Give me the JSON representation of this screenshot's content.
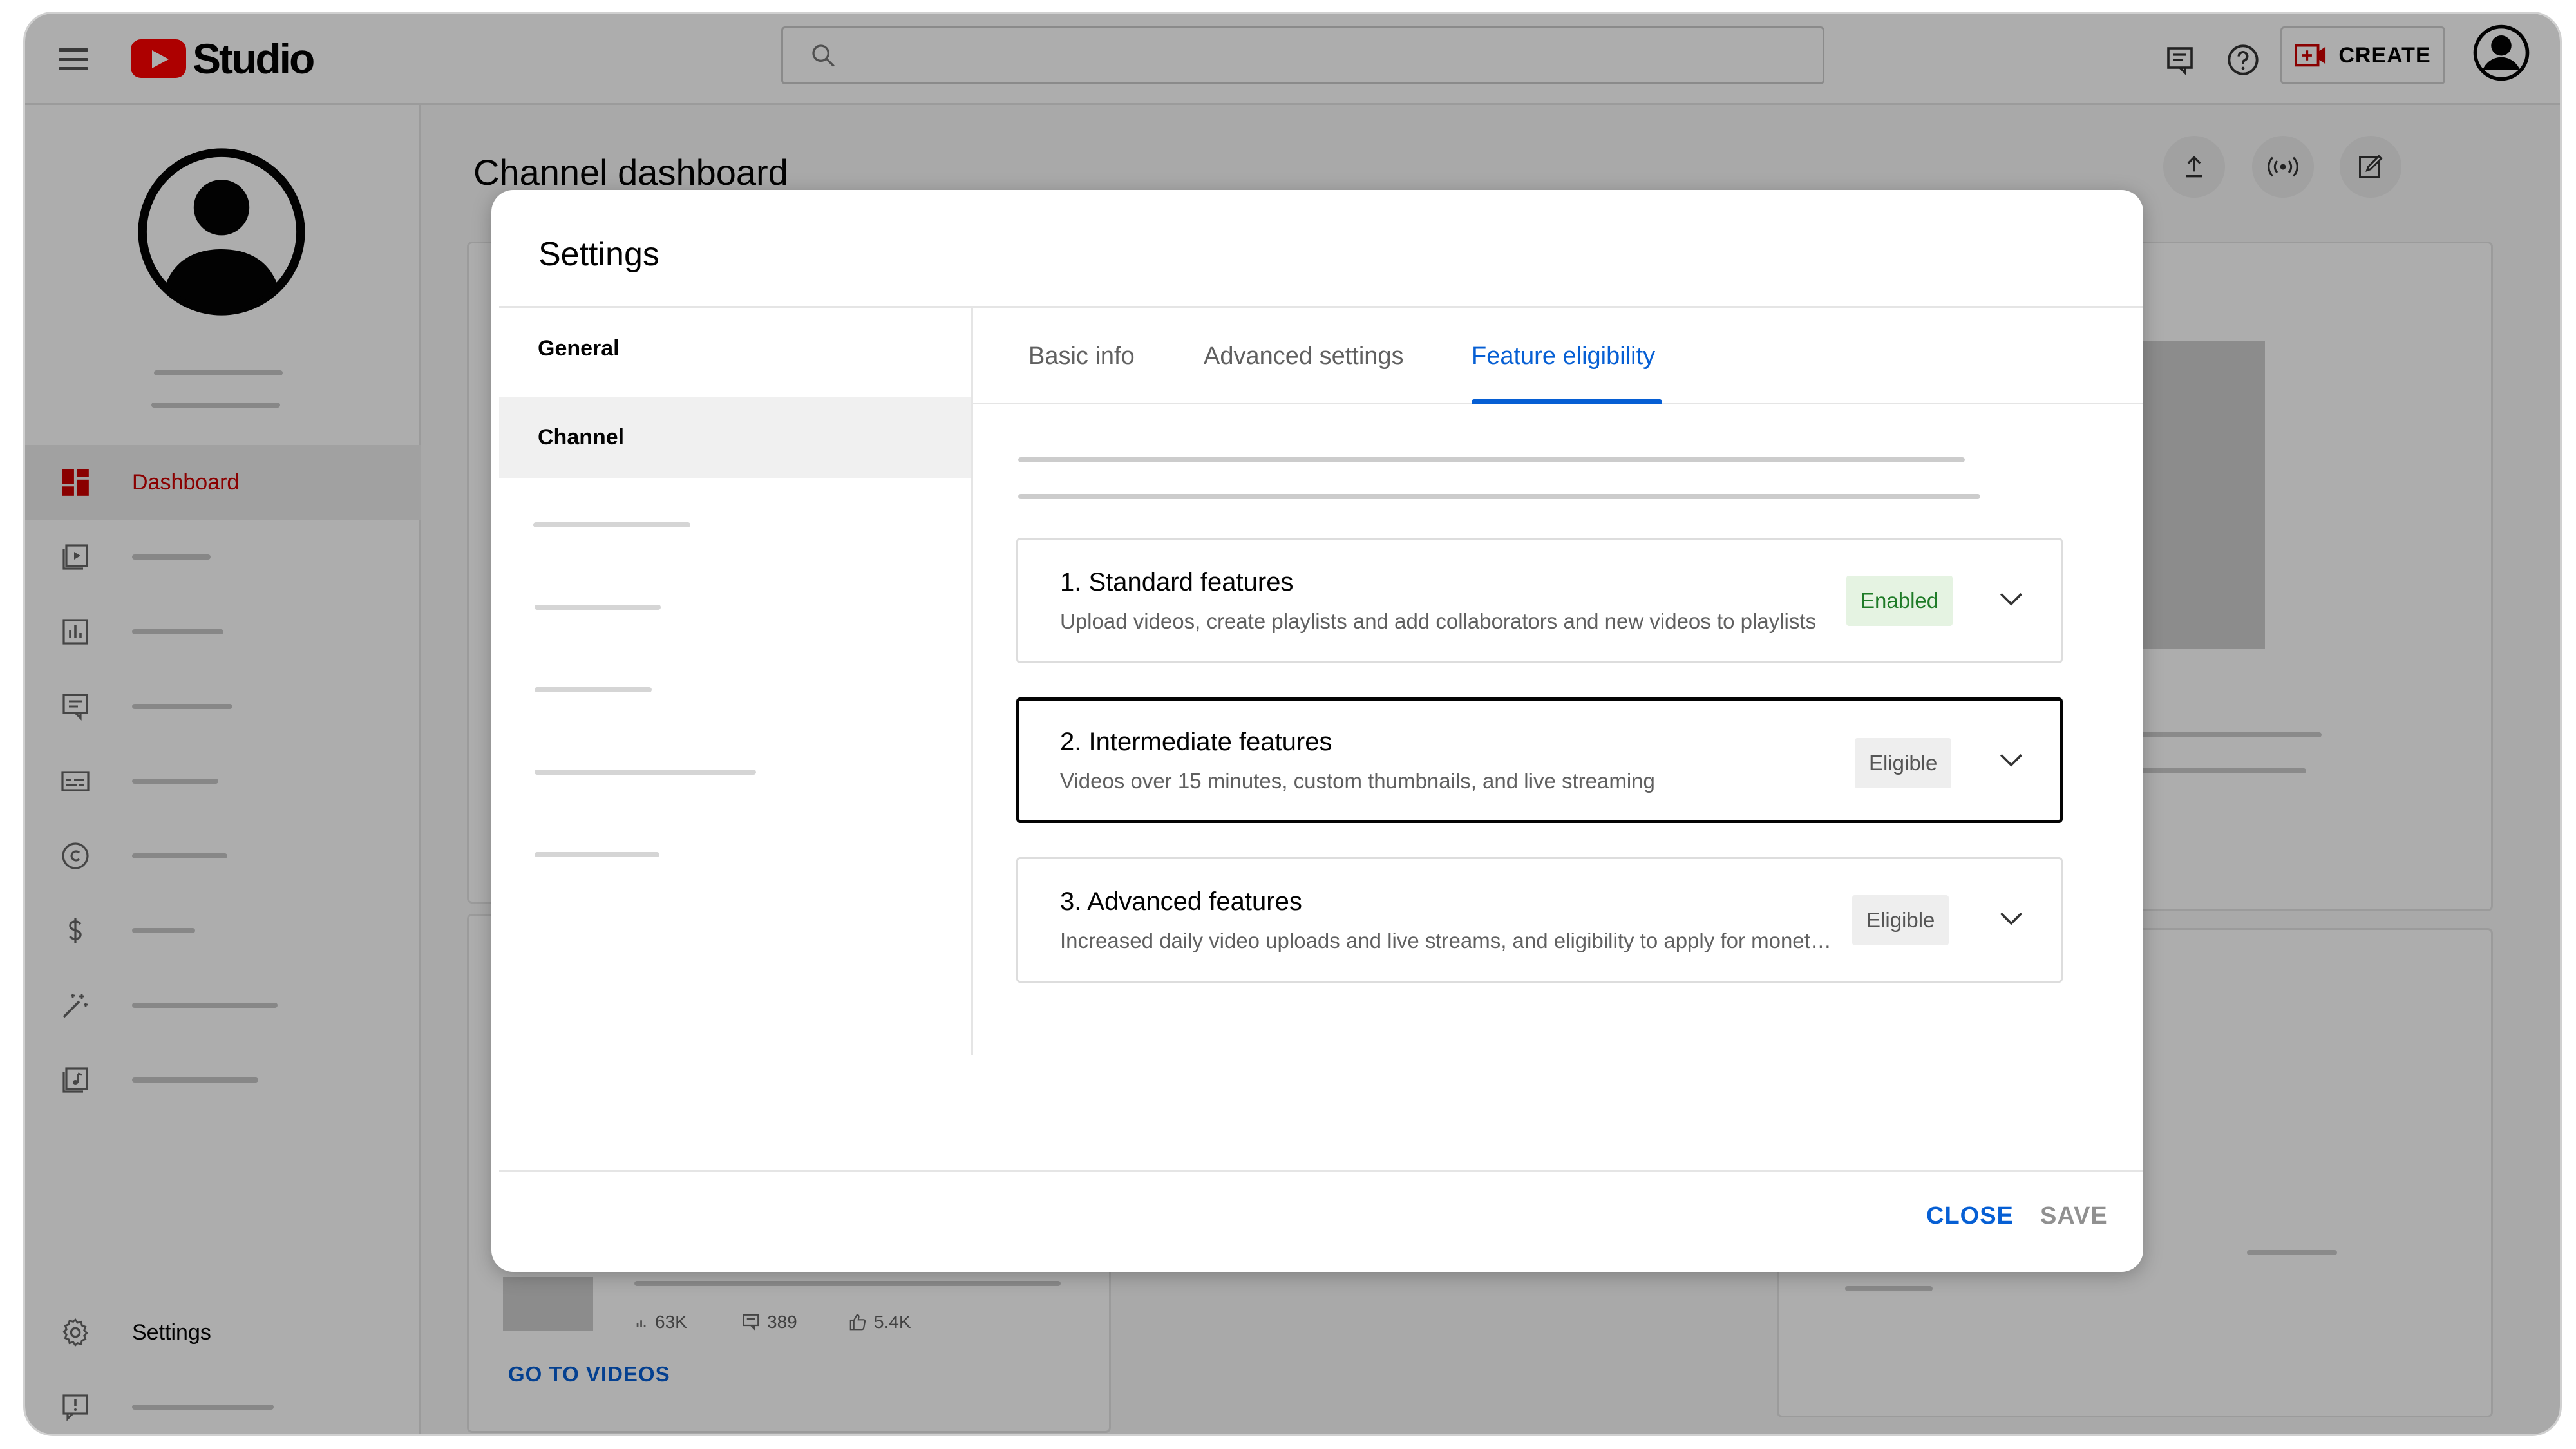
{
  "header": {
    "logo_text": "Studio",
    "create_label": "CREATE"
  },
  "sidebar": {
    "items": [
      {
        "label": "Dashboard",
        "icon": "dashboard-icon",
        "active": true
      },
      {
        "label": "",
        "icon": "content-icon"
      },
      {
        "label": "",
        "icon": "analytics-icon"
      },
      {
        "label": "",
        "icon": "comments-icon"
      },
      {
        "label": "",
        "icon": "subtitles-icon"
      },
      {
        "label": "",
        "icon": "copyright-icon"
      },
      {
        "label": "",
        "icon": "earn-icon"
      },
      {
        "label": "",
        "icon": "customization-icon"
      },
      {
        "label": "",
        "icon": "audio-library-icon"
      }
    ],
    "settings_label": "Settings",
    "feedback_icon": "feedback-icon"
  },
  "main": {
    "title": "Channel dashboard",
    "stats": {
      "views": "63K",
      "comments": "389",
      "likes": "5.4K"
    },
    "go_to_videos": "GO TO VIDEOS"
  },
  "settings_dialog": {
    "title": "Settings",
    "nav": [
      {
        "label": "General",
        "active": false
      },
      {
        "label": "Channel",
        "active": true
      }
    ],
    "tabs": [
      {
        "label": "Basic info",
        "active": false
      },
      {
        "label": "Advanced settings",
        "active": false
      },
      {
        "label": "Feature eligibility",
        "active": true
      }
    ],
    "features": [
      {
        "title": "1. Standard features",
        "description": "Upload videos, create playlists and add collaborators and new videos to playlists",
        "status": "Enabled",
        "status_color": "#1e7b27",
        "selected": false
      },
      {
        "title": "2. Intermediate features",
        "description": "Videos over 15 minutes, custom thumbnails, and live streaming",
        "status": "Eligible",
        "status_color": "#555555",
        "selected": true
      },
      {
        "title": "3. Advanced features",
        "description": "Increased daily video uploads and live streams, and eligibility to apply for monetization",
        "status": "Eligible",
        "status_color": "#555555",
        "selected": false
      }
    ],
    "close_label": "CLOSE",
    "save_label": "SAVE"
  },
  "colors": {
    "accent_blue": "#065fd4",
    "brand_red": "#ff0000",
    "active_nav_red": "#cc0000"
  }
}
